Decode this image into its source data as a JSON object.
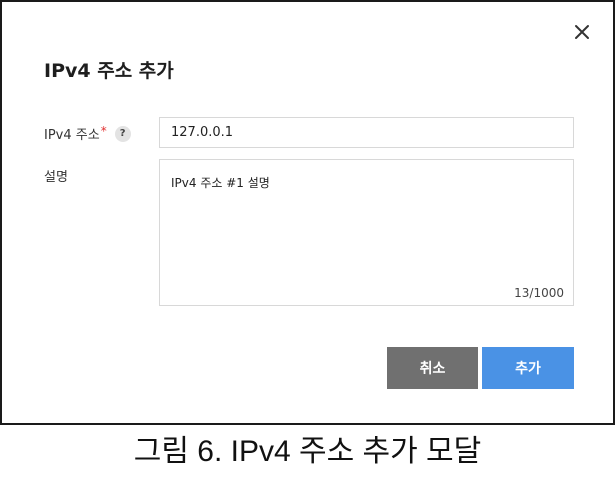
{
  "modal": {
    "title": "IPv4 주소 추가",
    "close_icon": "close-icon",
    "fields": {
      "ip": {
        "label": "IPv4 주소",
        "required_mark": "*",
        "help_glyph": "?",
        "help_icon": "help-icon",
        "value": "127.0.0.1"
      },
      "description": {
        "label": "설명",
        "value": "IPv4 주소 #1 설명",
        "char_count": "13/1000"
      }
    },
    "buttons": {
      "cancel_label": "취소",
      "add_label": "추가"
    },
    "colors": {
      "cancel_button": "#707070",
      "add_button": "#4a92e5",
      "required": "#e02f2f"
    }
  },
  "caption": "그림 6. IPv4 주소 추가 모달"
}
